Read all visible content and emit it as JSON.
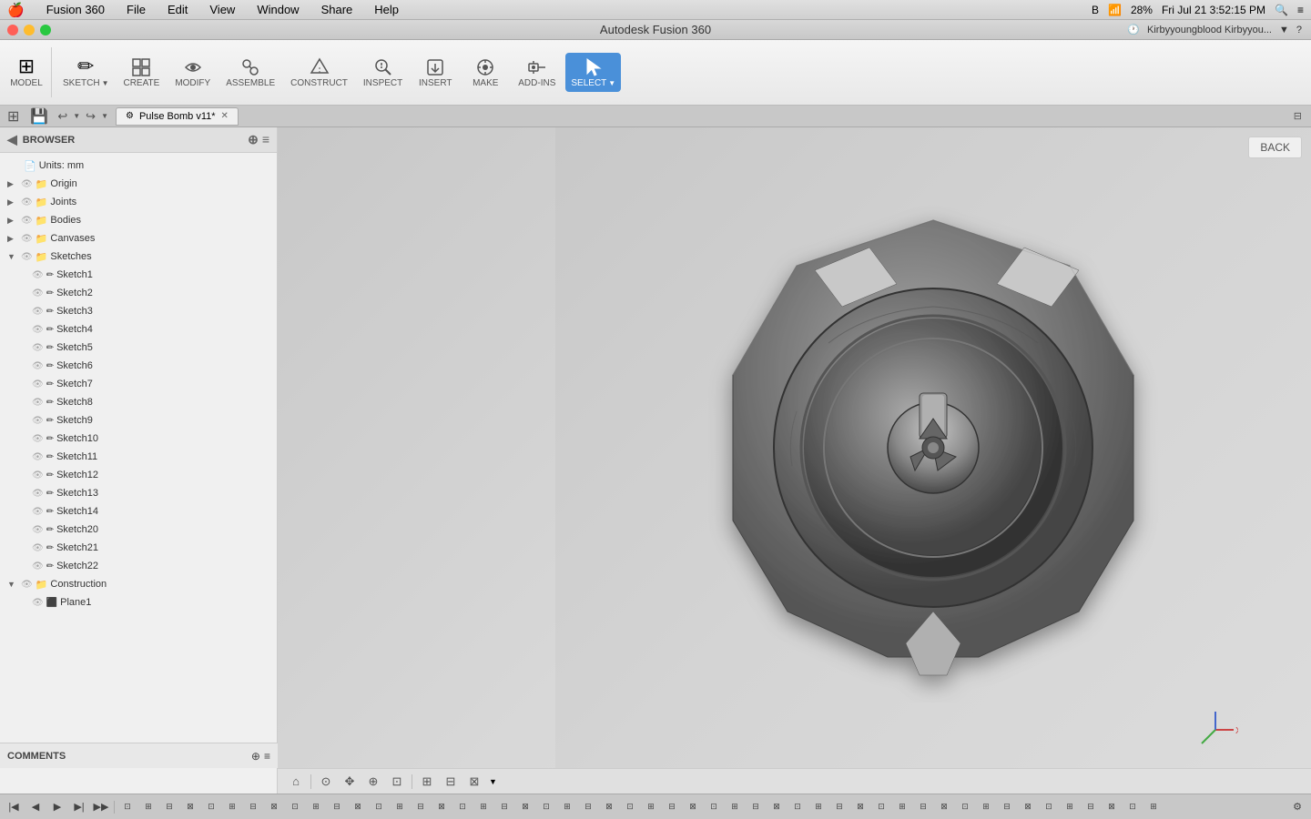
{
  "app": {
    "name": "Autodesk Fusion 360",
    "title": "Autodesk Fusion 360"
  },
  "menubar": {
    "apple": "🍎",
    "items": [
      "Fusion 360",
      "File",
      "Edit",
      "View",
      "Window",
      "Share",
      "Help"
    ],
    "right": {
      "time": "Fri Jul 21  3:52:15 PM",
      "battery": "28%",
      "wifi": "wifi",
      "bluetooth": "BT",
      "search_icon": "🔍"
    }
  },
  "titlebar": {
    "title": "Autodesk Fusion 360",
    "user": "Kirbyyoungblood Kirbyyou..."
  },
  "tab": {
    "label": "Pulse Bomb v11*",
    "icon": "⚙"
  },
  "toolbar": {
    "model_label": "MODEL",
    "groups": [
      {
        "icon": "✏",
        "label": "SKETCH",
        "id": "sketch"
      },
      {
        "icon": "⊕",
        "label": "CREATE",
        "id": "create"
      },
      {
        "icon": "✂",
        "label": "MODIFY",
        "id": "modify"
      },
      {
        "icon": "🔧",
        "label": "ASSEMBLE",
        "id": "assemble"
      },
      {
        "icon": "◈",
        "label": "CONSTRUCT",
        "id": "construct"
      },
      {
        "icon": "🔍",
        "label": "INSPECT",
        "id": "inspect"
      },
      {
        "icon": "↓",
        "label": "INSERT",
        "id": "insert"
      },
      {
        "icon": "⚙",
        "label": "MAKE",
        "id": "make"
      },
      {
        "icon": "＋",
        "label": "ADD-INS",
        "id": "addins"
      },
      {
        "icon": "⊡",
        "label": "SELECT",
        "id": "select",
        "active": true
      }
    ]
  },
  "browser": {
    "title": "BROWSER",
    "tree": [
      {
        "level": 0,
        "expand": false,
        "label": "Units: mm",
        "type": "file"
      },
      {
        "level": 0,
        "expand": false,
        "label": "Origin",
        "type": "folder",
        "has_expand": true
      },
      {
        "level": 0,
        "expand": false,
        "label": "Joints",
        "type": "folder",
        "has_expand": true
      },
      {
        "level": 0,
        "expand": false,
        "label": "Bodies",
        "type": "folder",
        "has_expand": true
      },
      {
        "level": 0,
        "expand": false,
        "label": "Canvases",
        "type": "folder",
        "has_expand": true
      },
      {
        "level": 0,
        "expand": true,
        "label": "Sketches",
        "type": "folder",
        "has_expand": true
      },
      {
        "level": 1,
        "label": "Sketch1",
        "type": "sketch"
      },
      {
        "level": 1,
        "label": "Sketch2",
        "type": "sketch"
      },
      {
        "level": 1,
        "label": "Sketch3",
        "type": "sketch"
      },
      {
        "level": 1,
        "label": "Sketch4",
        "type": "sketch"
      },
      {
        "level": 1,
        "label": "Sketch5",
        "type": "sketch"
      },
      {
        "level": 1,
        "label": "Sketch6",
        "type": "sketch"
      },
      {
        "level": 1,
        "label": "Sketch7",
        "type": "sketch"
      },
      {
        "level": 1,
        "label": "Sketch8",
        "type": "sketch"
      },
      {
        "level": 1,
        "label": "Sketch9",
        "type": "sketch"
      },
      {
        "level": 1,
        "label": "Sketch10",
        "type": "sketch"
      },
      {
        "level": 1,
        "label": "Sketch11",
        "type": "sketch"
      },
      {
        "level": 1,
        "label": "Sketch12",
        "type": "sketch"
      },
      {
        "level": 1,
        "label": "Sketch13",
        "type": "sketch"
      },
      {
        "level": 1,
        "label": "Sketch14",
        "type": "sketch"
      },
      {
        "level": 1,
        "label": "Sketch20",
        "type": "sketch"
      },
      {
        "level": 1,
        "label": "Sketch21",
        "type": "sketch"
      },
      {
        "level": 1,
        "label": "Sketch22",
        "type": "sketch"
      },
      {
        "level": 0,
        "expand": true,
        "label": "Construction",
        "type": "folder",
        "has_expand": true
      },
      {
        "level": 1,
        "label": "Plane1",
        "type": "plane"
      }
    ]
  },
  "viewport": {
    "back_button": "BACK",
    "axis_x": "X"
  },
  "comments": {
    "label": "COMMENTS"
  },
  "bottom_toolbar": {
    "buttons": [
      "⟳",
      "⊡",
      "✥",
      "⊕",
      "⊙",
      "⊟",
      "⊞",
      "⊟",
      "⊠"
    ]
  }
}
